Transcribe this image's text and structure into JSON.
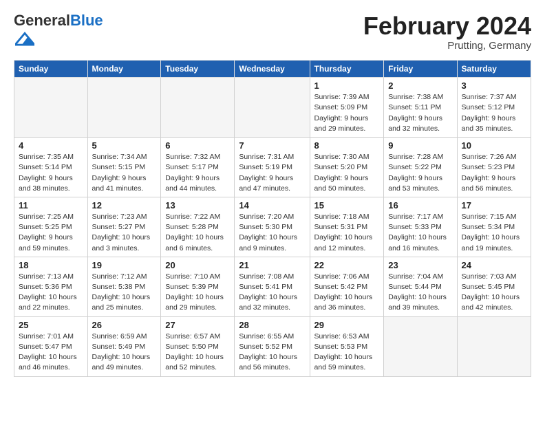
{
  "header": {
    "logo_general": "General",
    "logo_blue": "Blue",
    "title": "February 2024",
    "subtitle": "Prutting, Germany"
  },
  "days_of_week": [
    "Sunday",
    "Monday",
    "Tuesday",
    "Wednesday",
    "Thursday",
    "Friday",
    "Saturday"
  ],
  "weeks": [
    [
      {
        "day": "",
        "empty": true
      },
      {
        "day": "",
        "empty": true
      },
      {
        "day": "",
        "empty": true
      },
      {
        "day": "",
        "empty": true
      },
      {
        "day": "1",
        "sunrise": "7:39 AM",
        "sunset": "5:09 PM",
        "daylight": "9 hours and 29 minutes."
      },
      {
        "day": "2",
        "sunrise": "7:38 AM",
        "sunset": "5:11 PM",
        "daylight": "9 hours and 32 minutes."
      },
      {
        "day": "3",
        "sunrise": "7:37 AM",
        "sunset": "5:12 PM",
        "daylight": "9 hours and 35 minutes."
      }
    ],
    [
      {
        "day": "4",
        "sunrise": "7:35 AM",
        "sunset": "5:14 PM",
        "daylight": "9 hours and 38 minutes."
      },
      {
        "day": "5",
        "sunrise": "7:34 AM",
        "sunset": "5:15 PM",
        "daylight": "9 hours and 41 minutes."
      },
      {
        "day": "6",
        "sunrise": "7:32 AM",
        "sunset": "5:17 PM",
        "daylight": "9 hours and 44 minutes."
      },
      {
        "day": "7",
        "sunrise": "7:31 AM",
        "sunset": "5:19 PM",
        "daylight": "9 hours and 47 minutes."
      },
      {
        "day": "8",
        "sunrise": "7:30 AM",
        "sunset": "5:20 PM",
        "daylight": "9 hours and 50 minutes."
      },
      {
        "day": "9",
        "sunrise": "7:28 AM",
        "sunset": "5:22 PM",
        "daylight": "9 hours and 53 minutes."
      },
      {
        "day": "10",
        "sunrise": "7:26 AM",
        "sunset": "5:23 PM",
        "daylight": "9 hours and 56 minutes."
      }
    ],
    [
      {
        "day": "11",
        "sunrise": "7:25 AM",
        "sunset": "5:25 PM",
        "daylight": "9 hours and 59 minutes."
      },
      {
        "day": "12",
        "sunrise": "7:23 AM",
        "sunset": "5:27 PM",
        "daylight": "10 hours and 3 minutes."
      },
      {
        "day": "13",
        "sunrise": "7:22 AM",
        "sunset": "5:28 PM",
        "daylight": "10 hours and 6 minutes."
      },
      {
        "day": "14",
        "sunrise": "7:20 AM",
        "sunset": "5:30 PM",
        "daylight": "10 hours and 9 minutes."
      },
      {
        "day": "15",
        "sunrise": "7:18 AM",
        "sunset": "5:31 PM",
        "daylight": "10 hours and 12 minutes."
      },
      {
        "day": "16",
        "sunrise": "7:17 AM",
        "sunset": "5:33 PM",
        "daylight": "10 hours and 16 minutes."
      },
      {
        "day": "17",
        "sunrise": "7:15 AM",
        "sunset": "5:34 PM",
        "daylight": "10 hours and 19 minutes."
      }
    ],
    [
      {
        "day": "18",
        "sunrise": "7:13 AM",
        "sunset": "5:36 PM",
        "daylight": "10 hours and 22 minutes."
      },
      {
        "day": "19",
        "sunrise": "7:12 AM",
        "sunset": "5:38 PM",
        "daylight": "10 hours and 25 minutes."
      },
      {
        "day": "20",
        "sunrise": "7:10 AM",
        "sunset": "5:39 PM",
        "daylight": "10 hours and 29 minutes."
      },
      {
        "day": "21",
        "sunrise": "7:08 AM",
        "sunset": "5:41 PM",
        "daylight": "10 hours and 32 minutes."
      },
      {
        "day": "22",
        "sunrise": "7:06 AM",
        "sunset": "5:42 PM",
        "daylight": "10 hours and 36 minutes."
      },
      {
        "day": "23",
        "sunrise": "7:04 AM",
        "sunset": "5:44 PM",
        "daylight": "10 hours and 39 minutes."
      },
      {
        "day": "24",
        "sunrise": "7:03 AM",
        "sunset": "5:45 PM",
        "daylight": "10 hours and 42 minutes."
      }
    ],
    [
      {
        "day": "25",
        "sunrise": "7:01 AM",
        "sunset": "5:47 PM",
        "daylight": "10 hours and 46 minutes."
      },
      {
        "day": "26",
        "sunrise": "6:59 AM",
        "sunset": "5:49 PM",
        "daylight": "10 hours and 49 minutes."
      },
      {
        "day": "27",
        "sunrise": "6:57 AM",
        "sunset": "5:50 PM",
        "daylight": "10 hours and 52 minutes."
      },
      {
        "day": "28",
        "sunrise": "6:55 AM",
        "sunset": "5:52 PM",
        "daylight": "10 hours and 56 minutes."
      },
      {
        "day": "29",
        "sunrise": "6:53 AM",
        "sunset": "5:53 PM",
        "daylight": "10 hours and 59 minutes."
      },
      {
        "day": "",
        "empty": true
      },
      {
        "day": "",
        "empty": true
      }
    ]
  ]
}
